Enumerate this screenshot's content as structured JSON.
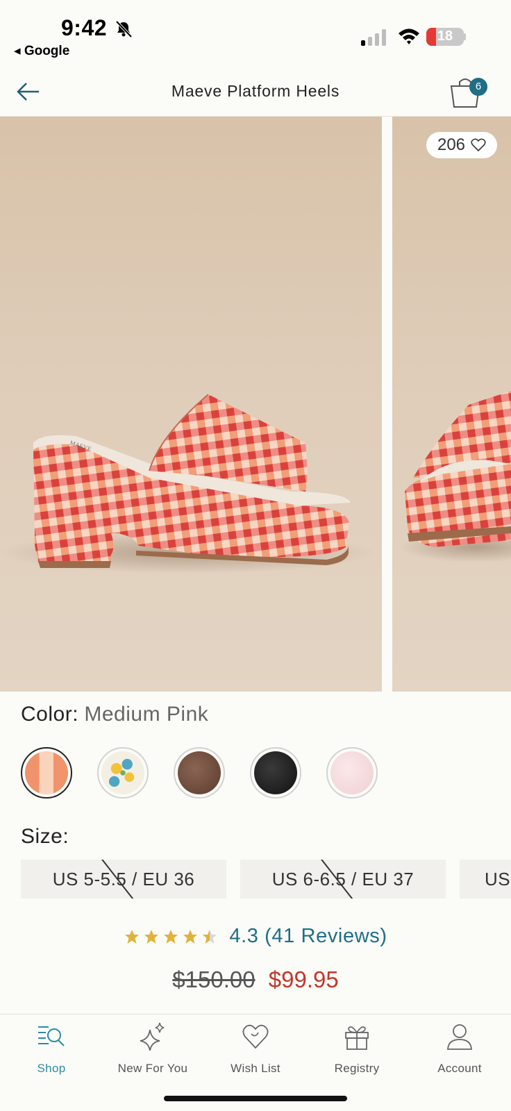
{
  "status_bar": {
    "time": "9:42",
    "back_app": "◂ Google",
    "battery_level": "18"
  },
  "header": {
    "title": "Maeve Platform Heels",
    "cart_count": "6"
  },
  "gallery": {
    "wishlist_count": "206",
    "photos": [
      "photo-1",
      "photo-2"
    ],
    "brand_mark": "MAEVE"
  },
  "product": {
    "color_label": "Color:",
    "color_value": "Medium Pink",
    "swatches": [
      {
        "name": "medium-pink-gingham",
        "selected": true
      },
      {
        "name": "floral",
        "selected": false
      },
      {
        "name": "brown",
        "selected": false
      },
      {
        "name": "black",
        "selected": false
      },
      {
        "name": "light-pink",
        "selected": false
      }
    ],
    "size_label": "Size:",
    "sizes": [
      {
        "label": "US 5-5.5 / EU 36",
        "unavailable": true
      },
      {
        "label": "US 6-6.5 / EU 37",
        "unavailable": true
      },
      {
        "label": "US",
        "unavailable": false
      }
    ],
    "rating": 4.3,
    "rating_text": "4.3 (41 Reviews)",
    "old_price": "$150.00",
    "new_price": "$99.95"
  },
  "colors": {
    "accent": "#1f6e86",
    "sale": "#c0392b",
    "star": "#e0b33a"
  },
  "bottom_nav": [
    {
      "label": "Shop",
      "icon": "shop-search-icon",
      "active": true
    },
    {
      "label": "New For You",
      "icon": "sparkle-icon",
      "active": false
    },
    {
      "label": "Wish List",
      "icon": "heart-icon",
      "active": false
    },
    {
      "label": "Registry",
      "icon": "gift-icon",
      "active": false
    },
    {
      "label": "Account",
      "icon": "person-icon",
      "active": false
    }
  ]
}
